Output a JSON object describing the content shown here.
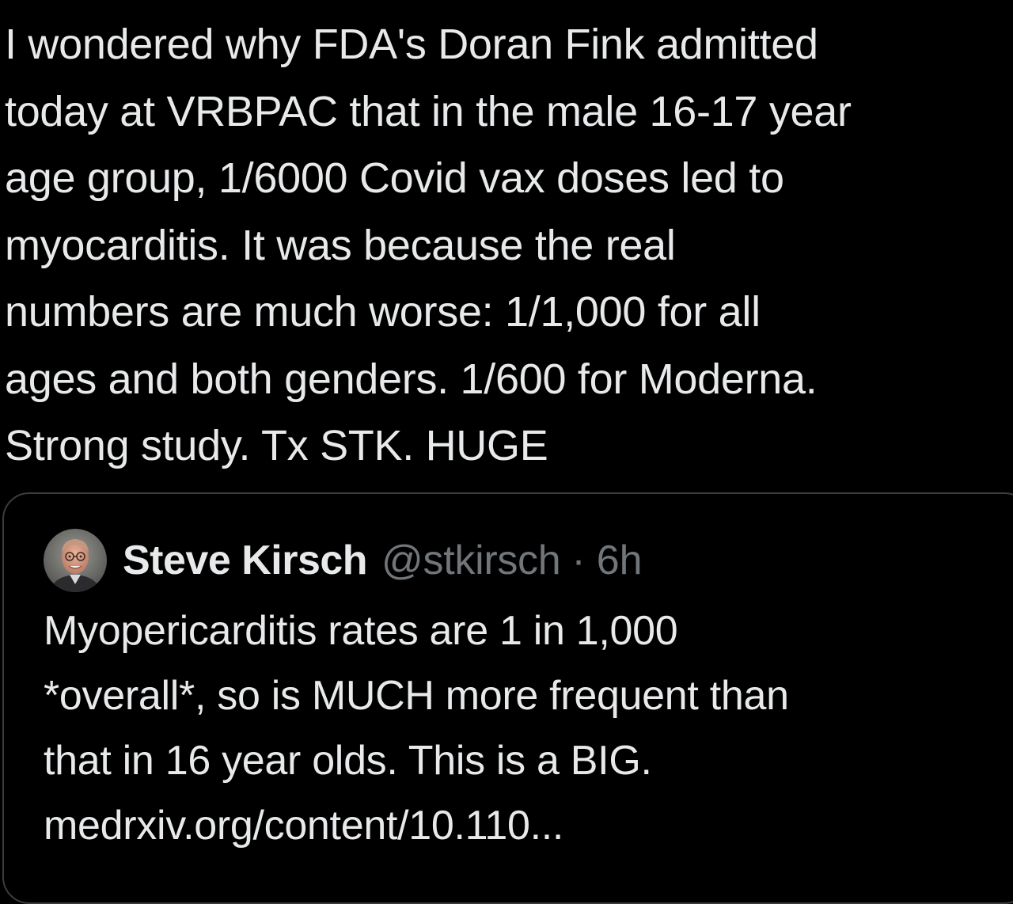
{
  "tweet": {
    "text_lines": [
      "I wondered why FDA's Doran Fink admitted",
      "today at VRBPAC that in the male 16-17 year",
      "age group, 1/6000 Covid vax doses led to",
      "myocarditis.  It was because the real",
      "numbers are much worse:  1/1,000 for all",
      "ages and both genders. 1/600 for Moderna.",
      "Strong study. Tx STK. HUGE"
    ]
  },
  "quoted_tweet": {
    "author_name": "Steve Kirsch",
    "author_handle": "@stkirsch",
    "separator": "·",
    "timestamp": "6h",
    "avatar_icon": "avatar-photo",
    "text_lines": [
      "Myopericarditis rates are 1 in 1,000",
      "*overall*, so is MUCH more frequent than",
      "that in 16 year olds. This is a BIG."
    ],
    "link_text": "medrxiv.org/content/10.110..."
  },
  "colors": {
    "background": "#000000",
    "text_primary": "#e7e9ea",
    "text_secondary": "#71767b",
    "card_border": "#3a3d40"
  }
}
